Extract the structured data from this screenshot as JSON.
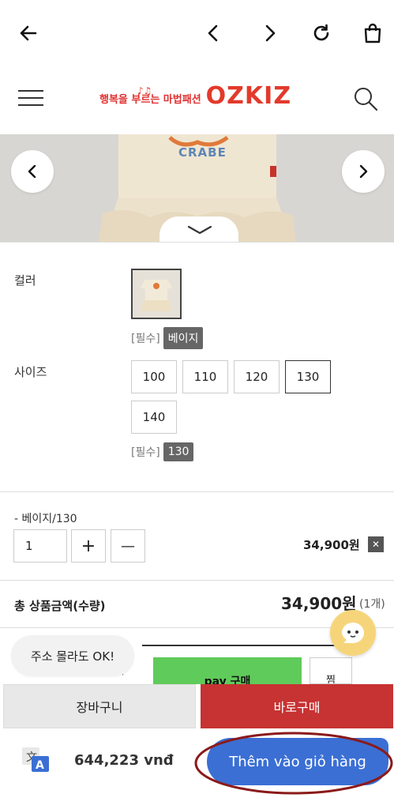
{
  "top_bar": {
    "back_icon": "arrow-left-icon",
    "prev_icon": "chevron-left-icon",
    "next_icon": "chevron-right-icon",
    "reload_icon": "reload-icon",
    "bag_icon": "shopping-bag-icon"
  },
  "header": {
    "menu_icon": "hamburger-icon",
    "logo_korean": "행복을 부르는 마법패션",
    "logo_brand": "OZKIZ",
    "search_icon": "search-icon"
  },
  "product_image": {
    "print_text": "CRABE"
  },
  "options": {
    "color_label": "컬러",
    "color_required": "[필수]",
    "color_selected": "베이지",
    "size_label": "사이즈",
    "sizes": [
      "100",
      "110",
      "120",
      "130",
      "140"
    ],
    "size_selected": "130",
    "size_required": "[필수]"
  },
  "selected_item": {
    "name": "- 베이지/130",
    "quantity": "1",
    "plus": "+",
    "minus": "—",
    "price": "34,900원",
    "remove": "✕"
  },
  "total": {
    "label": "총 상품금액(수량)",
    "price": "34,900원",
    "count": "(1개)"
  },
  "popup": {
    "bubble_text": "주소 몰라도 OK!",
    "npay_text": "pay 구매",
    "wish_text": "찜"
  },
  "bottom_buttons": {
    "cart": "장바구니",
    "buy_now": "바로구매"
  },
  "translate_bar": {
    "price": "644,223 vnđ",
    "add_to_cart": "Thêm vào giỏ hàng"
  },
  "colors": {
    "brand_red": "#e23a2c",
    "buy_button": "#c73232",
    "add_button": "#3b6fd4",
    "highlight_ellipse": "#8b1a1a",
    "chat_yellow": "#f6d57a"
  }
}
